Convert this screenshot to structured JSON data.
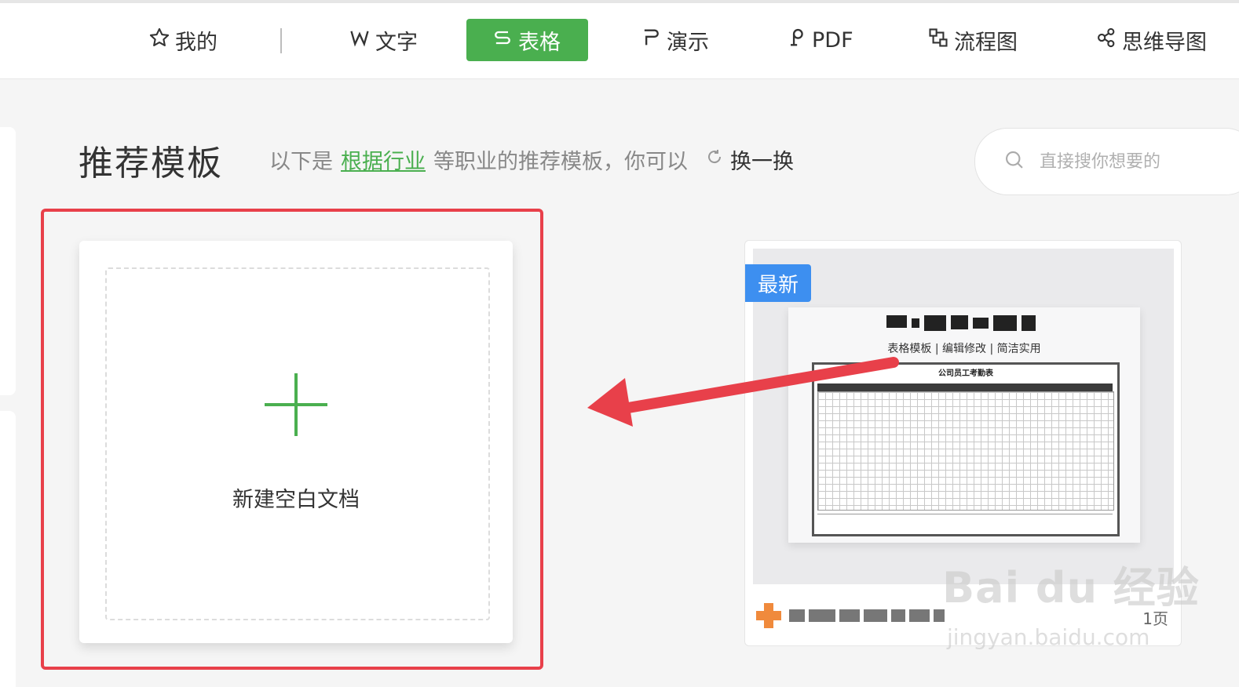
{
  "nav": {
    "items": [
      {
        "label": "我的",
        "icon": "star-icon"
      },
      {
        "label": "文字",
        "icon": "word-w-icon"
      },
      {
        "label": "表格",
        "icon": "sheet-s-icon",
        "active": true
      },
      {
        "label": "演示",
        "icon": "presentation-p-icon"
      },
      {
        "label": "PDF",
        "icon": "pdf-icon"
      },
      {
        "label": "流程图",
        "icon": "flowchart-icon"
      },
      {
        "label": "思维导图",
        "icon": "mindmap-icon"
      }
    ],
    "accent_color": "#4aaf4f"
  },
  "section": {
    "title": "推荐模板",
    "subtitle_prefix": "以下是",
    "industry_link": "根据行业",
    "subtitle_suffix": "等职业的推荐模板，你可以",
    "refresh_label": "换一换"
  },
  "search": {
    "placeholder": "直接搜你想要的"
  },
  "blank_doc": {
    "label": "新建空白文档"
  },
  "template": {
    "badge": "最新",
    "tags": "表格模板 | 编辑修改 | 简洁实用",
    "sheet_title": "公司员工考勤表",
    "pages": "1页",
    "badge_color": "#3d8ff0"
  },
  "watermark": {
    "brand": "Bai du 经验",
    "url": "jingyan.baidu.com"
  },
  "annotation": {
    "highlight_color": "#e8404a"
  }
}
